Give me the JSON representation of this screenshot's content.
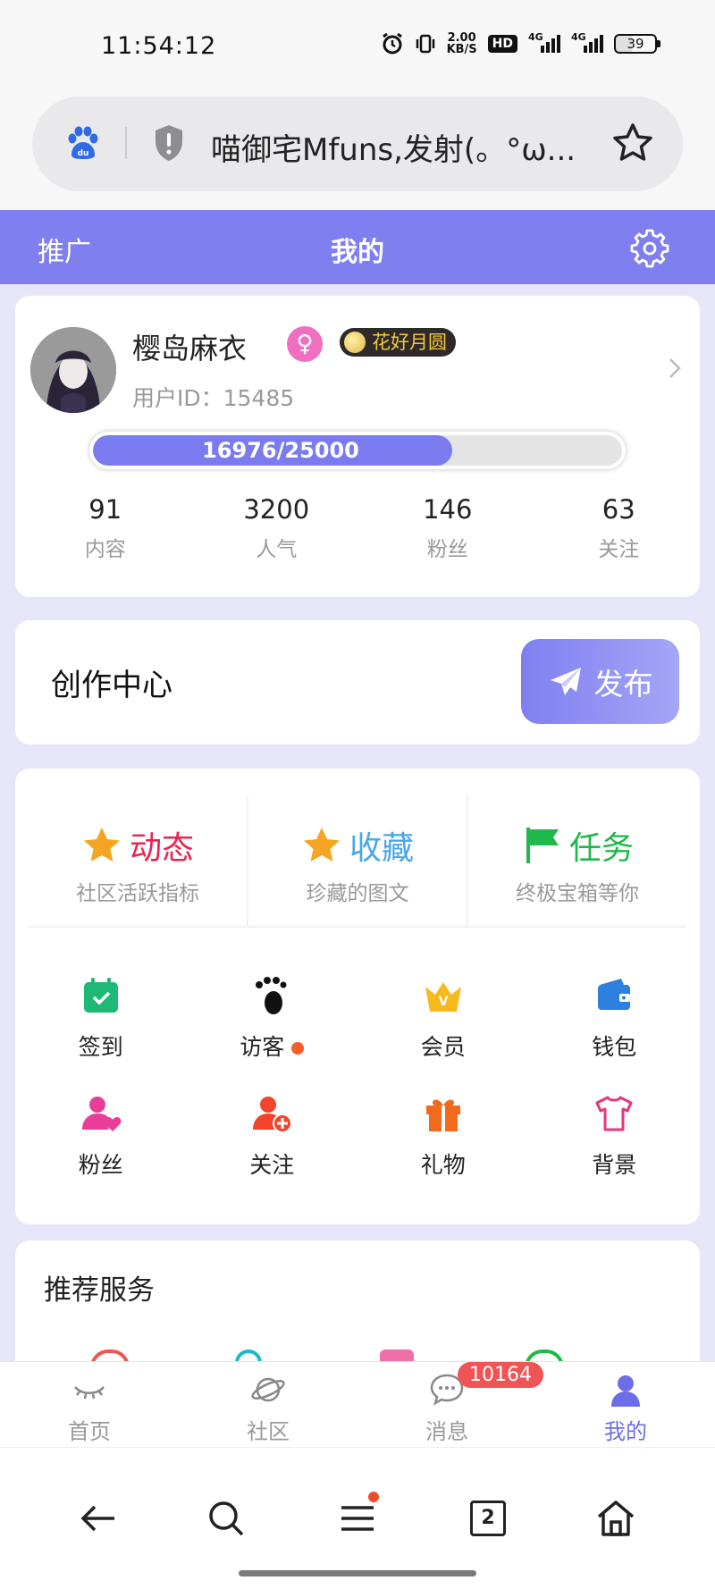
{
  "status_bar": {
    "time": "11:54:12",
    "net_speed_value": "2.00",
    "net_speed_unit": "KB/S",
    "hd_label": "HD",
    "signal1_label": "4G",
    "signal2_label": "4G",
    "battery": "39"
  },
  "browser": {
    "page_title": "喵御宅Mfuns,发射(。°ω...",
    "tab_count": "2"
  },
  "header": {
    "promo_label": "推广",
    "title": "我的"
  },
  "profile": {
    "username": "樱岛麻衣",
    "gender_symbol": "♀",
    "badge_label": "花好月圆",
    "user_id": "用户ID：15485",
    "xp_text": "16976/25000",
    "xp_fraction": 0.679,
    "stats": [
      {
        "value": "91",
        "label": "内容"
      },
      {
        "value": "3200",
        "label": "人气"
      },
      {
        "value": "146",
        "label": "粉丝"
      },
      {
        "value": "63",
        "label": "关注"
      }
    ]
  },
  "creation": {
    "title": "创作中心",
    "publish_label": "发布"
  },
  "features": {
    "big": [
      {
        "name": "动态",
        "sub": "社区活跃指标",
        "color": "#e8244f",
        "icon": "star-icon"
      },
      {
        "name": "收藏",
        "sub": "珍藏的图文",
        "color": "#4aa6e8",
        "icon": "star-icon"
      },
      {
        "name": "任务",
        "sub": "终极宝箱等你",
        "color": "#1fb84a",
        "icon": "flag-icon"
      }
    ],
    "grid": [
      {
        "label": "签到",
        "icon": "calendar-check-icon"
      },
      {
        "label": "访客",
        "icon": "footprint-icon"
      },
      {
        "label": "会员",
        "icon": "crown-icon"
      },
      {
        "label": "钱包",
        "icon": "wallet-icon"
      },
      {
        "label": "粉丝",
        "icon": "user-heart-icon"
      },
      {
        "label": "关注",
        "icon": "user-add-icon"
      },
      {
        "label": "礼物",
        "icon": "gift-icon"
      },
      {
        "label": "背景",
        "icon": "tshirt-icon"
      }
    ]
  },
  "recommend": {
    "title": "推荐服务"
  },
  "tabbar": {
    "tabs": [
      {
        "label": "首页",
        "icon": "eye-closed-icon"
      },
      {
        "label": "社区",
        "icon": "planet-icon"
      },
      {
        "label": "消息",
        "icon": "chat-bubble-icon"
      },
      {
        "label": "我的",
        "icon": "user-icon"
      }
    ],
    "message_badge": "10164"
  },
  "colors": {
    "accent": "#7f7ff0",
    "publish_gradient_start": "#7f7ff2",
    "publish_gradient_end": "#a5a6f6",
    "badge_red": "#f05454"
  }
}
